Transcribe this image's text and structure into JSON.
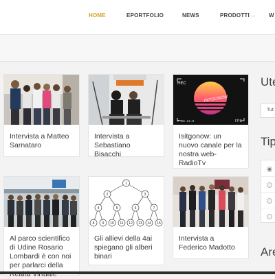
{
  "nav": {
    "items": [
      {
        "label": "HOME",
        "active": true
      },
      {
        "label": "EPORTFOLIO",
        "active": false
      },
      {
        "label": "NEWS",
        "active": false
      },
      {
        "label": "PRODOTTI",
        "active": false,
        "has_dropdown": true
      },
      {
        "label": "W",
        "active": false
      }
    ],
    "accent_color": "#d4a11e"
  },
  "cards": [
    {
      "title": "Intervista a Matteo Sarnataro",
      "image": "group-photo"
    },
    {
      "title": "Intervista a Sebastiano Bisacchi",
      "image": "studio-interview"
    },
    {
      "title": "Isitgonow: un nuovo canale per la nostra web-RadioTv",
      "image": "camera-viewfinder",
      "image_text": {
        "rec": "REC",
        "logo": "ISITGONOW",
        "fps": "FPS",
        "info": "F 66.12.0"
      }
    },
    {
      "title": "Al parco scientifico di Udine Rosario Lombardi è con noi per parlarci della Realtà Virtuale",
      "image": "lab-group"
    },
    {
      "title": "Gli allievi della 4ai spiegano gli alberi binari",
      "image": "binary-tree",
      "tree_nodes": [
        "1",
        "2",
        "3",
        "4",
        "5",
        "6",
        "7",
        "8",
        "9",
        "10",
        "11",
        "12",
        "13",
        "14",
        "15"
      ]
    },
    {
      "title": "Intervista a Federico Madotto",
      "image": "people-standing"
    }
  ],
  "sidebar": {
    "heading1": "Ute",
    "select_value": "Tut",
    "heading2": "Tip",
    "heading3": "Are"
  }
}
